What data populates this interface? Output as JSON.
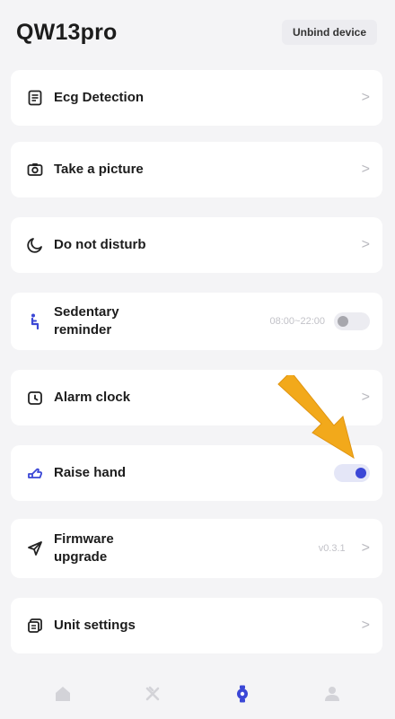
{
  "header": {
    "title": "QW13pro",
    "unbind_label": "Unbind device"
  },
  "items": [
    {
      "label": "Ecg Detection",
      "icon": "ecg-document-icon",
      "chevron": ">"
    },
    {
      "label": "Take a picture",
      "icon": "camera-icon",
      "chevron": ">"
    },
    {
      "label": "Do not disturb",
      "icon": "moon-icon",
      "chevron": ">"
    },
    {
      "label": "Sedentary reminder",
      "icon": "sitting-person-icon",
      "value": "08:00~22:00",
      "toggle": false
    },
    {
      "label": "Alarm clock",
      "icon": "alarm-clock-icon",
      "chevron": ">"
    },
    {
      "label": "Raise hand",
      "icon": "hand-icon",
      "toggle": true
    },
    {
      "label": "Firmware upgrade",
      "icon": "paper-plane-icon",
      "value": "v0.3.1",
      "chevron": ">"
    },
    {
      "label": "Unit settings",
      "icon": "unit-settings-icon",
      "chevron": ">"
    }
  ],
  "tabbar": {
    "tabs": [
      {
        "icon": "home-icon",
        "active": false
      },
      {
        "icon": "sport-icon",
        "active": false
      },
      {
        "icon": "watch-icon",
        "active": true
      },
      {
        "icon": "profile-icon",
        "active": false
      }
    ]
  },
  "colors": {
    "accent": "#3b47d6",
    "annotation_arrow": "#f2a91b",
    "background": "#f4f4f6",
    "card": "#ffffff"
  }
}
